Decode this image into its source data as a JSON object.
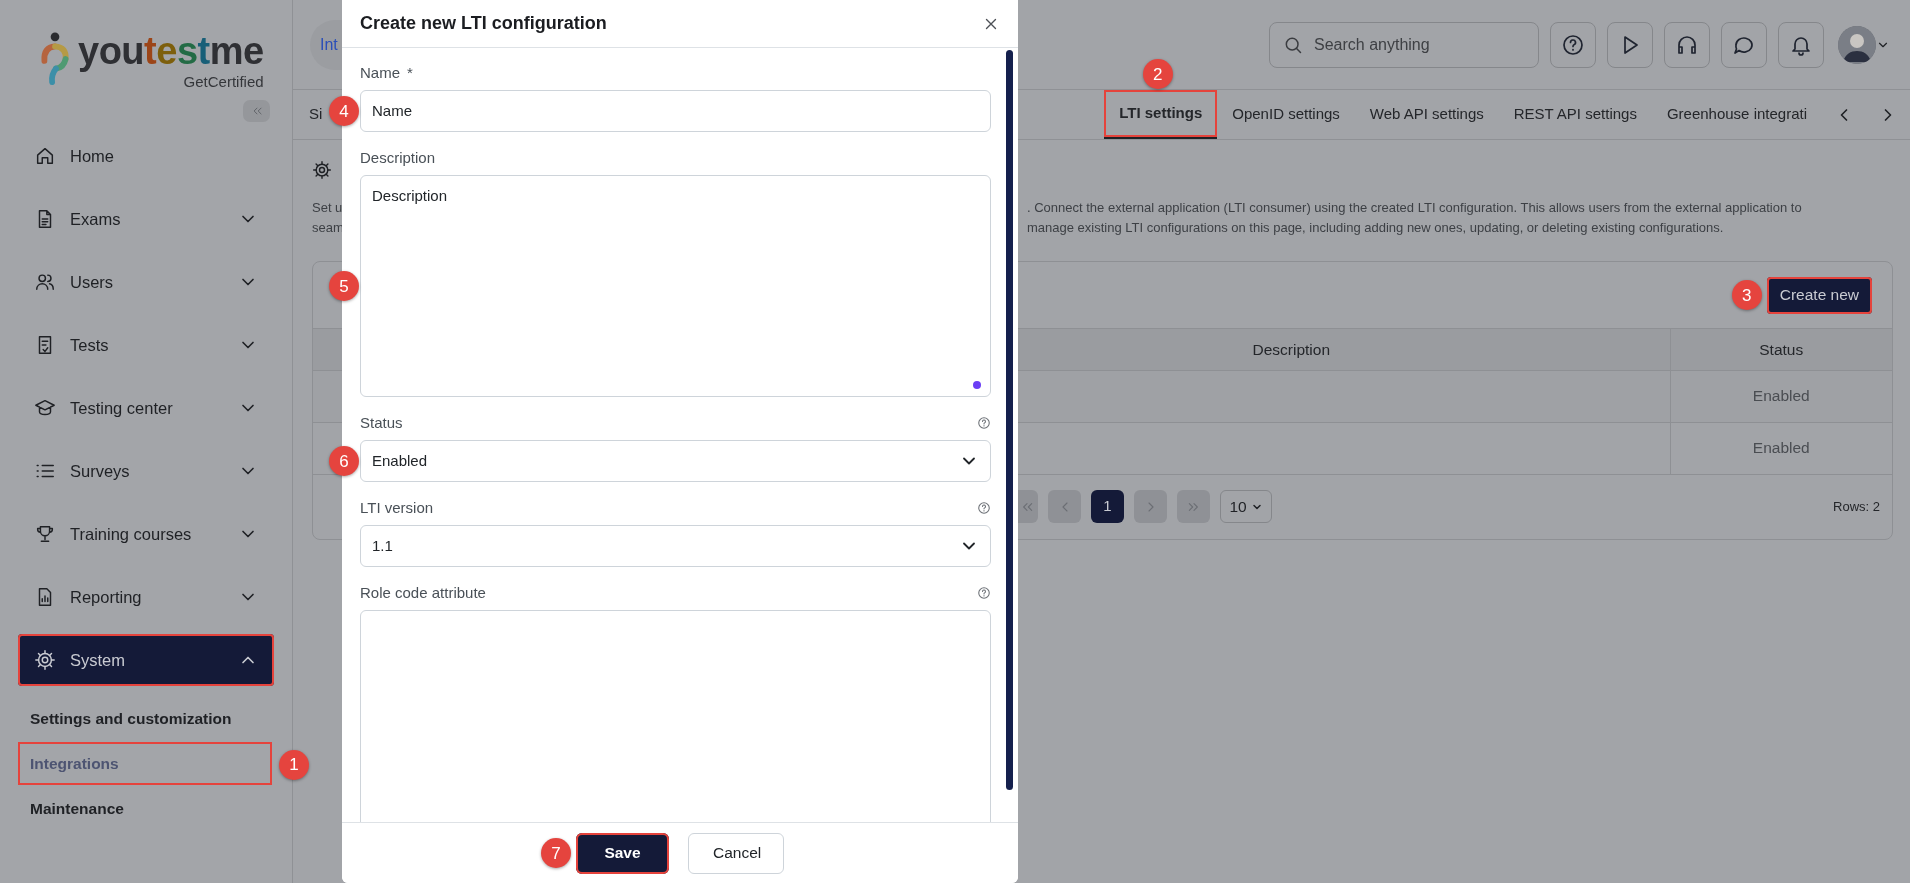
{
  "logo": {
    "name": "youtestme",
    "tagline": "GetCertified"
  },
  "sidebar": {
    "items": [
      {
        "kind": "link",
        "label": "Home"
      },
      {
        "kind": "group",
        "label": "Exams",
        "expanded": false
      },
      {
        "kind": "group",
        "label": "Users",
        "expanded": false
      },
      {
        "kind": "group",
        "label": "Tests",
        "expanded": false
      },
      {
        "kind": "group",
        "label": "Testing center",
        "expanded": false
      },
      {
        "kind": "group",
        "label": "Surveys",
        "expanded": false
      },
      {
        "kind": "group",
        "label": "Training courses",
        "expanded": false
      },
      {
        "kind": "group",
        "label": "Reporting",
        "expanded": false
      },
      {
        "kind": "group",
        "label": "System",
        "expanded": true,
        "highlighted": true,
        "children": [
          {
            "label": "Settings and customization",
            "selected": false,
            "highlighted": false
          },
          {
            "label": "Integrations",
            "selected": true,
            "highlighted": true,
            "marker": "1"
          },
          {
            "label": "Maintenance",
            "selected": false,
            "highlighted": false
          }
        ]
      }
    ]
  },
  "header": {
    "breadcrumb": "Int",
    "search": {
      "placeholder": "Search anything"
    }
  },
  "tabs": [
    {
      "label": "Si",
      "selected": false,
      "highlighted": false
    },
    {
      "label": "LTI settings",
      "selected": true,
      "highlighted": true,
      "marker": "2"
    },
    {
      "label": "OpenID settings",
      "selected": false,
      "highlighted": false
    },
    {
      "label": "Web API settings",
      "selected": false,
      "highlighted": false
    },
    {
      "label": "REST API settings",
      "selected": false,
      "highlighted": false
    },
    {
      "label": "Greenhouse integrati",
      "selected": false,
      "highlighted": false
    }
  ],
  "section": {
    "text_left": [
      "Set u",
      "seam"
    ],
    "text_right": [
      ". Connect the external application (LTI consumer) using the created LTI configuration. This allows users from the external application to",
      "manage existing LTI configurations on this page, including adding new ones, updating, or deleting existing configurations."
    ]
  },
  "card": {
    "create_button": {
      "label": "Create new",
      "highlighted": true,
      "marker": "3"
    },
    "table": {
      "columns": [
        "Description",
        "Status"
      ],
      "rows": [
        {
          "status": "Enabled"
        },
        {
          "status": "Enabled"
        }
      ]
    },
    "pagination": {
      "buttons": [
        {
          "kind": "first",
          "disabled": true
        },
        {
          "kind": "prev",
          "disabled": true
        },
        {
          "kind": "page",
          "label": "1",
          "selected": true
        },
        {
          "kind": "next",
          "disabled": true
        },
        {
          "kind": "last",
          "disabled": true
        }
      ],
      "page_size": "10",
      "rows_text": "Rows: 2"
    }
  },
  "modal": {
    "title": "Create new LTI configuration",
    "fields": [
      {
        "kind": "input",
        "label": "Name",
        "required_mark": "*",
        "value": "Name",
        "marker": "4"
      },
      {
        "kind": "textarea",
        "label": "Description",
        "value": "Description",
        "marker": "5",
        "status_dot": true
      },
      {
        "kind": "select",
        "label": "Status",
        "help": true,
        "value": "Enabled",
        "marker": "6"
      },
      {
        "kind": "select",
        "label": "LTI version",
        "help": true,
        "value": "1.1"
      },
      {
        "kind": "textarea",
        "label": "Role code attribute",
        "help": true
      }
    ],
    "buttons": [
      {
        "label": "Save",
        "kind": "primary",
        "highlighted": true,
        "marker": "7"
      },
      {
        "label": "Cancel",
        "kind": "secondary",
        "highlighted": false
      }
    ]
  }
}
